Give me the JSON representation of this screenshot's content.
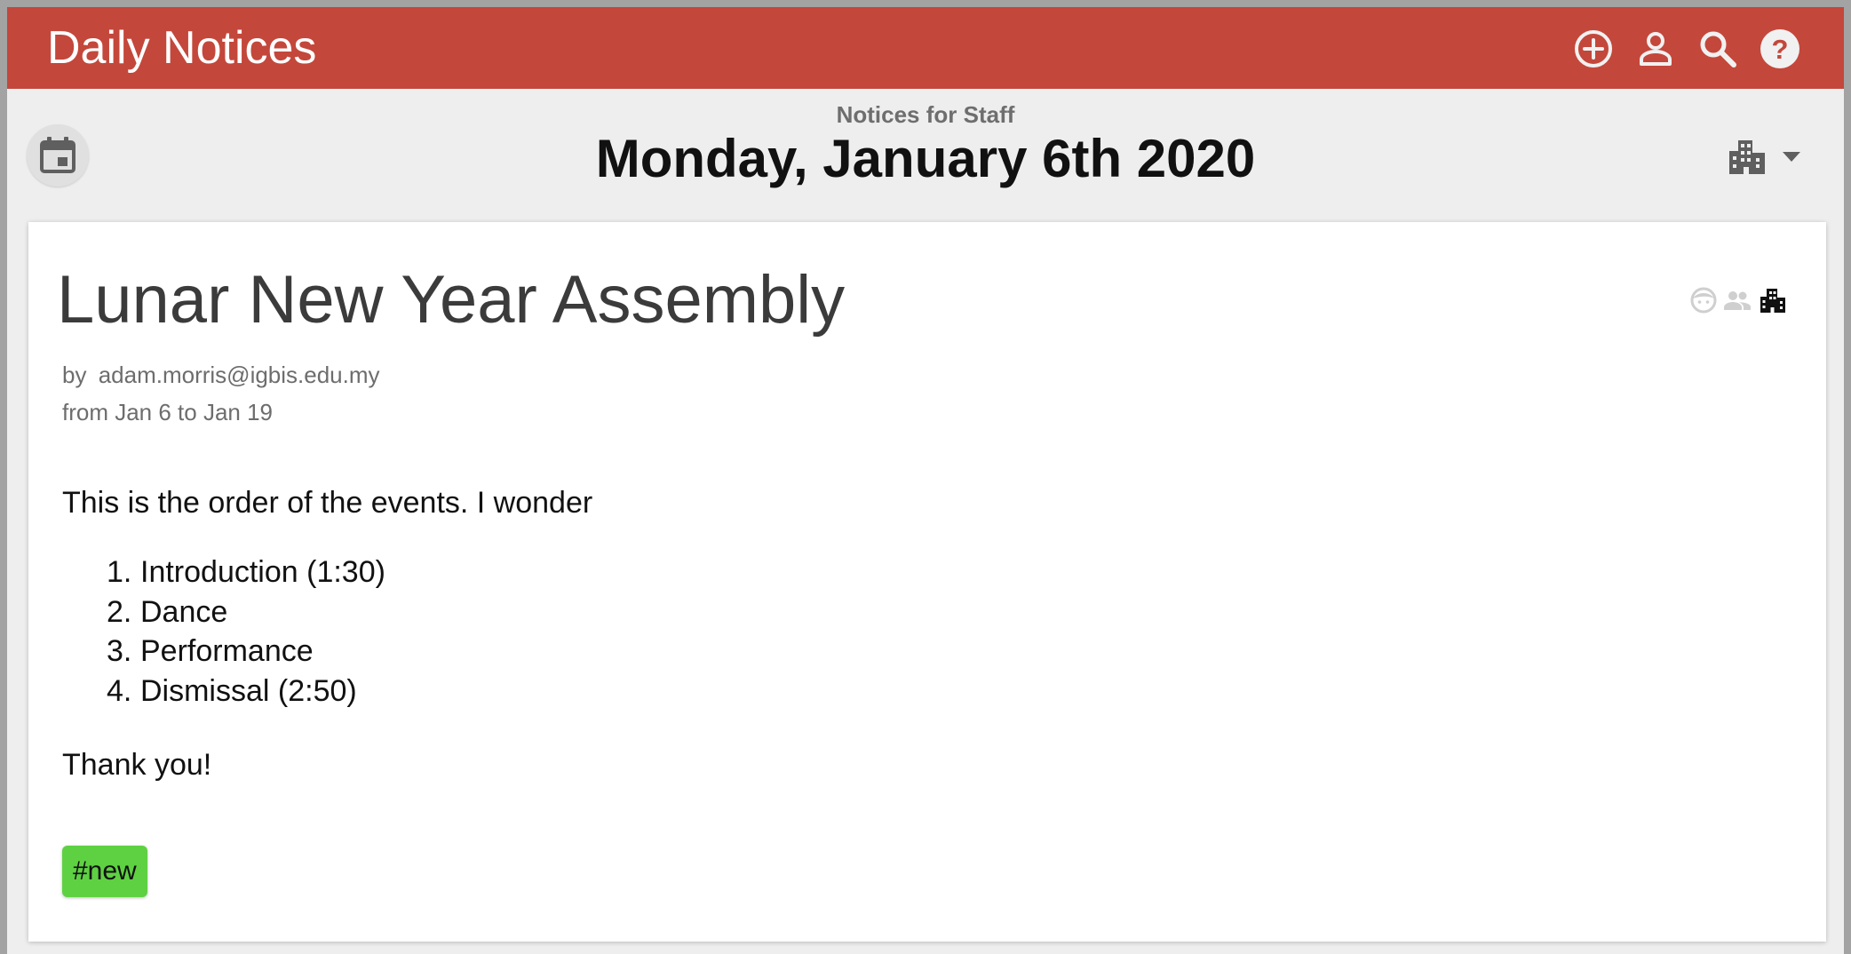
{
  "app": {
    "title": "Daily Notices",
    "actions": [
      {
        "name": "add-circle-icon",
        "label": "Add notice"
      },
      {
        "name": "account-icon",
        "label": "Account"
      },
      {
        "name": "search-icon",
        "label": "Search"
      },
      {
        "name": "help-icon",
        "label": "Help"
      }
    ]
  },
  "header": {
    "audience": "Notices for Staff",
    "date": "Monday, January 6th 2020",
    "calendar_icon": "calendar-icon",
    "filter_icon": "building-icon",
    "filter_caret_icon": "dropdown-caret-icon"
  },
  "notice": {
    "title": "Lunar New Year Assembly",
    "by_label": "by",
    "author": "adam.morris@igbis.edu.my",
    "dates": "from Jan 6 to Jan 19",
    "intro": "This is the order of the events. I wonder",
    "items": [
      {
        "num": "1.",
        "text": "Introduction (1:30)"
      },
      {
        "num": "2.",
        "text": "Dance"
      },
      {
        "num": "3.",
        "text": "Performance"
      },
      {
        "num": "4.",
        "text": "Dismissal (2:50)"
      }
    ],
    "outro": "Thank you!",
    "tag": "#new",
    "audience_icons": [
      "student-face-icon",
      "parents-icon",
      "staff-building-icon"
    ]
  },
  "colors": {
    "appbar": "#c4473b",
    "page_background": "#eeeeee",
    "card": "#ffffff",
    "tag": "#5ed142",
    "audience_icon_inactive": "#cfcfcf",
    "audience_icon_active": "#111111"
  }
}
